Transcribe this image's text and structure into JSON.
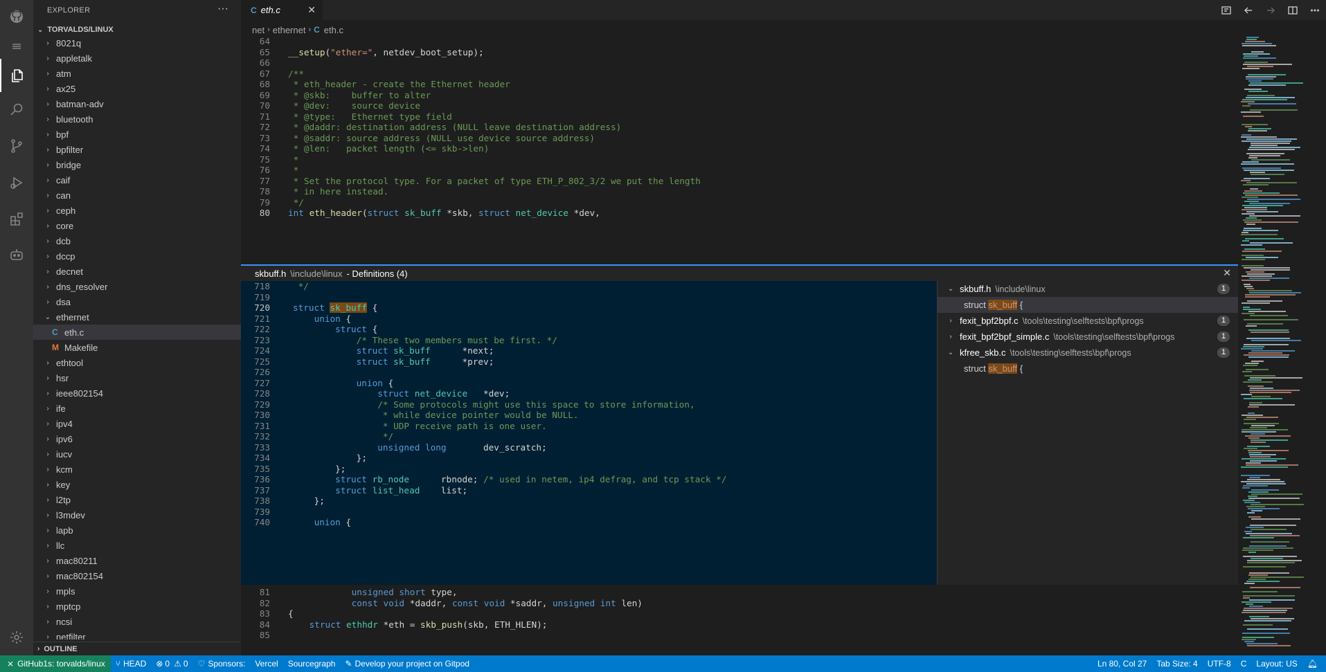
{
  "explorer": {
    "title": "EXPLORER",
    "more": "···",
    "repo": "TORVALDS/LINUX",
    "items": [
      {
        "label": "8021q",
        "kind": "folder"
      },
      {
        "label": "appletalk",
        "kind": "folder"
      },
      {
        "label": "atm",
        "kind": "folder"
      },
      {
        "label": "ax25",
        "kind": "folder"
      },
      {
        "label": "batman-adv",
        "kind": "folder"
      },
      {
        "label": "bluetooth",
        "kind": "folder"
      },
      {
        "label": "bpf",
        "kind": "folder"
      },
      {
        "label": "bpfilter",
        "kind": "folder"
      },
      {
        "label": "bridge",
        "kind": "folder"
      },
      {
        "label": "caif",
        "kind": "folder"
      },
      {
        "label": "can",
        "kind": "folder"
      },
      {
        "label": "ceph",
        "kind": "folder"
      },
      {
        "label": "core",
        "kind": "folder"
      },
      {
        "label": "dcb",
        "kind": "folder"
      },
      {
        "label": "dccp",
        "kind": "folder"
      },
      {
        "label": "decnet",
        "kind": "folder"
      },
      {
        "label": "dns_resolver",
        "kind": "folder"
      },
      {
        "label": "dsa",
        "kind": "folder"
      },
      {
        "label": "ethernet",
        "kind": "open-folder"
      },
      {
        "label": "eth.c",
        "kind": "c-file"
      },
      {
        "label": "Makefile",
        "kind": "make-file"
      },
      {
        "label": "ethtool",
        "kind": "folder"
      },
      {
        "label": "hsr",
        "kind": "folder"
      },
      {
        "label": "ieee802154",
        "kind": "folder"
      },
      {
        "label": "ife",
        "kind": "folder"
      },
      {
        "label": "ipv4",
        "kind": "folder"
      },
      {
        "label": "ipv6",
        "kind": "folder"
      },
      {
        "label": "iucv",
        "kind": "folder"
      },
      {
        "label": "kcm",
        "kind": "folder"
      },
      {
        "label": "key",
        "kind": "folder"
      },
      {
        "label": "l2tp",
        "kind": "folder"
      },
      {
        "label": "l3mdev",
        "kind": "folder"
      },
      {
        "label": "lapb",
        "kind": "folder"
      },
      {
        "label": "llc",
        "kind": "folder"
      },
      {
        "label": "mac80211",
        "kind": "folder"
      },
      {
        "label": "mac802154",
        "kind": "folder"
      },
      {
        "label": "mpls",
        "kind": "folder"
      },
      {
        "label": "mptcp",
        "kind": "folder"
      },
      {
        "label": "ncsi",
        "kind": "folder"
      },
      {
        "label": "netfilter",
        "kind": "folder"
      }
    ],
    "outline": "OUTLINE"
  },
  "tab": {
    "icon": "C",
    "label": "eth.c",
    "close": "✕"
  },
  "breadcrumb": {
    "p1": "net",
    "p2": "ethernet",
    "icon": "C",
    "p3": "eth.c"
  },
  "code_top": [
    {
      "n": "64",
      "t": ""
    },
    {
      "n": "65",
      "t": "__setup(\"ether=\", netdev_boot_setup);"
    },
    {
      "n": "66",
      "t": ""
    },
    {
      "n": "67",
      "t": "/**"
    },
    {
      "n": "68",
      "t": " * eth_header - create the Ethernet header"
    },
    {
      "n": "69",
      "t": " * @skb:    buffer to alter"
    },
    {
      "n": "70",
      "t": " * @dev:    source device"
    },
    {
      "n": "71",
      "t": " * @type:   Ethernet type field"
    },
    {
      "n": "72",
      "t": " * @daddr: destination address (NULL leave destination address)"
    },
    {
      "n": "73",
      "t": " * @saddr: source address (NULL use device source address)"
    },
    {
      "n": "74",
      "t": " * @len:   packet length (<= skb->len)"
    },
    {
      "n": "75",
      "t": " *"
    },
    {
      "n": "76",
      "t": " *"
    },
    {
      "n": "77",
      "t": " * Set the protocol type. For a packet of type ETH_P_802_3/2 we put the length"
    },
    {
      "n": "78",
      "t": " * in here instead."
    },
    {
      "n": "79",
      "t": " */"
    },
    {
      "n": "80",
      "t": "int eth_header(struct sk_buff *skb, struct net_device *dev,"
    }
  ],
  "peek": {
    "file": "skbuff.h",
    "path": "\\include\\linux",
    "title_suffix": "- Definitions (4)",
    "close": "✕",
    "code": [
      {
        "n": "718",
        "t": " */"
      },
      {
        "n": "719",
        "t": ""
      },
      {
        "n": "720",
        "t": "struct sk_buff {"
      },
      {
        "n": "721",
        "t": "    union {"
      },
      {
        "n": "722",
        "t": "        struct {"
      },
      {
        "n": "723",
        "t": "            /* These two members must be first. */"
      },
      {
        "n": "724",
        "t": "            struct sk_buff      *next;"
      },
      {
        "n": "725",
        "t": "            struct sk_buff      *prev;"
      },
      {
        "n": "726",
        "t": ""
      },
      {
        "n": "727",
        "t": "            union {"
      },
      {
        "n": "728",
        "t": "                struct net_device   *dev;"
      },
      {
        "n": "729",
        "t": "                /* Some protocols might use this space to store information,"
      },
      {
        "n": "730",
        "t": "                 * while device pointer would be NULL."
      },
      {
        "n": "731",
        "t": "                 * UDP receive path is one user."
      },
      {
        "n": "732",
        "t": "                 */"
      },
      {
        "n": "733",
        "t": "                unsigned long       dev_scratch;"
      },
      {
        "n": "734",
        "t": "            };"
      },
      {
        "n": "735",
        "t": "        };"
      },
      {
        "n": "736",
        "t": "        struct rb_node      rbnode; /* used in netem, ip4 defrag, and tcp stack */"
      },
      {
        "n": "737",
        "t": "        struct list_head    list;"
      },
      {
        "n": "738",
        "t": "    };"
      },
      {
        "n": "739",
        "t": ""
      },
      {
        "n": "740",
        "t": "    union {"
      }
    ],
    "refs": [
      {
        "file": "skbuff.h",
        "path": "\\include\\linux",
        "count": "1",
        "expanded": true
      },
      {
        "file": "fexit_bpf2bpf.c",
        "path": "\\tools\\testing\\selftests\\bpf\\progs",
        "count": "1",
        "expanded": false
      },
      {
        "file": "fexit_bpf2bpf_simple.c",
        "path": "\\tools\\testing\\selftests\\bpf\\progs",
        "count": "1",
        "expanded": false
      },
      {
        "file": "kfree_skb.c",
        "path": "\\tools\\testing\\selftests\\bpf\\progs",
        "count": "1",
        "expanded": true
      }
    ],
    "ref_child": {
      "pre": "struct ",
      "hl": "sk_buff",
      "post": " {"
    }
  },
  "code_bottom": [
    {
      "n": "81",
      "t": "            unsigned short type,"
    },
    {
      "n": "82",
      "t": "            const void *daddr, const void *saddr, unsigned int len)"
    },
    {
      "n": "83",
      "t": "{"
    },
    {
      "n": "84",
      "t": "    struct ethhdr *eth = skb_push(skb, ETH_HLEN);"
    },
    {
      "n": "85",
      "t": ""
    }
  ],
  "status": {
    "remote": "GitHub1s: torvalds/linux",
    "branch": "HEAD",
    "errors": "0",
    "warnings": "0",
    "sponsors": "Sponsors:",
    "vercel": "Vercel",
    "sourcegraph": "Sourcegraph",
    "gitpod": "Develop your project on Gitpod",
    "position": "Ln 80, Col 27",
    "tabsize": "Tab Size: 4",
    "encoding": "UTF-8",
    "eol": "C",
    "layout": "Layout: US"
  },
  "colors": {
    "statusbar": "#007acc",
    "remote": "#16825d",
    "peek_border": "#3794ff",
    "peek_bg": "#001f33"
  }
}
